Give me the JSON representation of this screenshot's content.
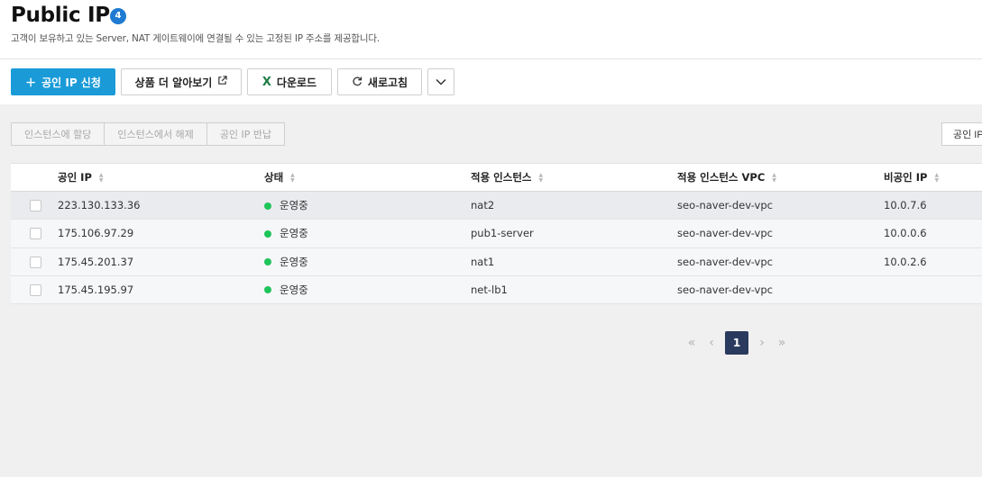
{
  "header": {
    "title": "Public IP",
    "count": "4",
    "subtitle": "고객이 보유하고 있는 Server, NAT 게이트웨이에 연결될 수 있는 고정된 IP 주소를 제공합니다."
  },
  "toolbar": {
    "apply_label": "공인 IP 신청",
    "learn_more_label": "상품 더 알아보기",
    "download_label": "다운로드",
    "refresh_label": "새로고침"
  },
  "actions": {
    "assign_label": "인스턴스에 할당",
    "unassign_label": "인스턴스에서 해제",
    "return_label": "공인 IP 반납",
    "right_label": "공인 IP"
  },
  "table": {
    "columns": [
      "공인 IP",
      "상태",
      "적용 인스턴스",
      "적용 인스턴스 VPC",
      "비공인 IP"
    ],
    "rows": [
      {
        "public_ip": "223.130.133.36",
        "status": "운영중",
        "instance": "nat2",
        "vpc": "seo-naver-dev-vpc",
        "private_ip": "10.0.7.6"
      },
      {
        "public_ip": "175.106.97.29",
        "status": "운영중",
        "instance": "pub1-server",
        "vpc": "seo-naver-dev-vpc",
        "private_ip": "10.0.0.6"
      },
      {
        "public_ip": "175.45.201.37",
        "status": "운영중",
        "instance": "nat1",
        "vpc": "seo-naver-dev-vpc",
        "private_ip": "10.0.2.6"
      },
      {
        "public_ip": "175.45.195.97",
        "status": "운영중",
        "instance": "net-lb1",
        "vpc": "seo-naver-dev-vpc",
        "private_ip": ""
      }
    ]
  },
  "pagination": {
    "current_page": "1",
    "first_icon": "«",
    "prev_icon": "‹",
    "next_icon": "›",
    "last_icon": "»"
  },
  "colors": {
    "primary": "#1a9bd8",
    "badge": "#1f7ad1",
    "status_running": "#1fc45a",
    "page_current": "#2a3a5e"
  }
}
